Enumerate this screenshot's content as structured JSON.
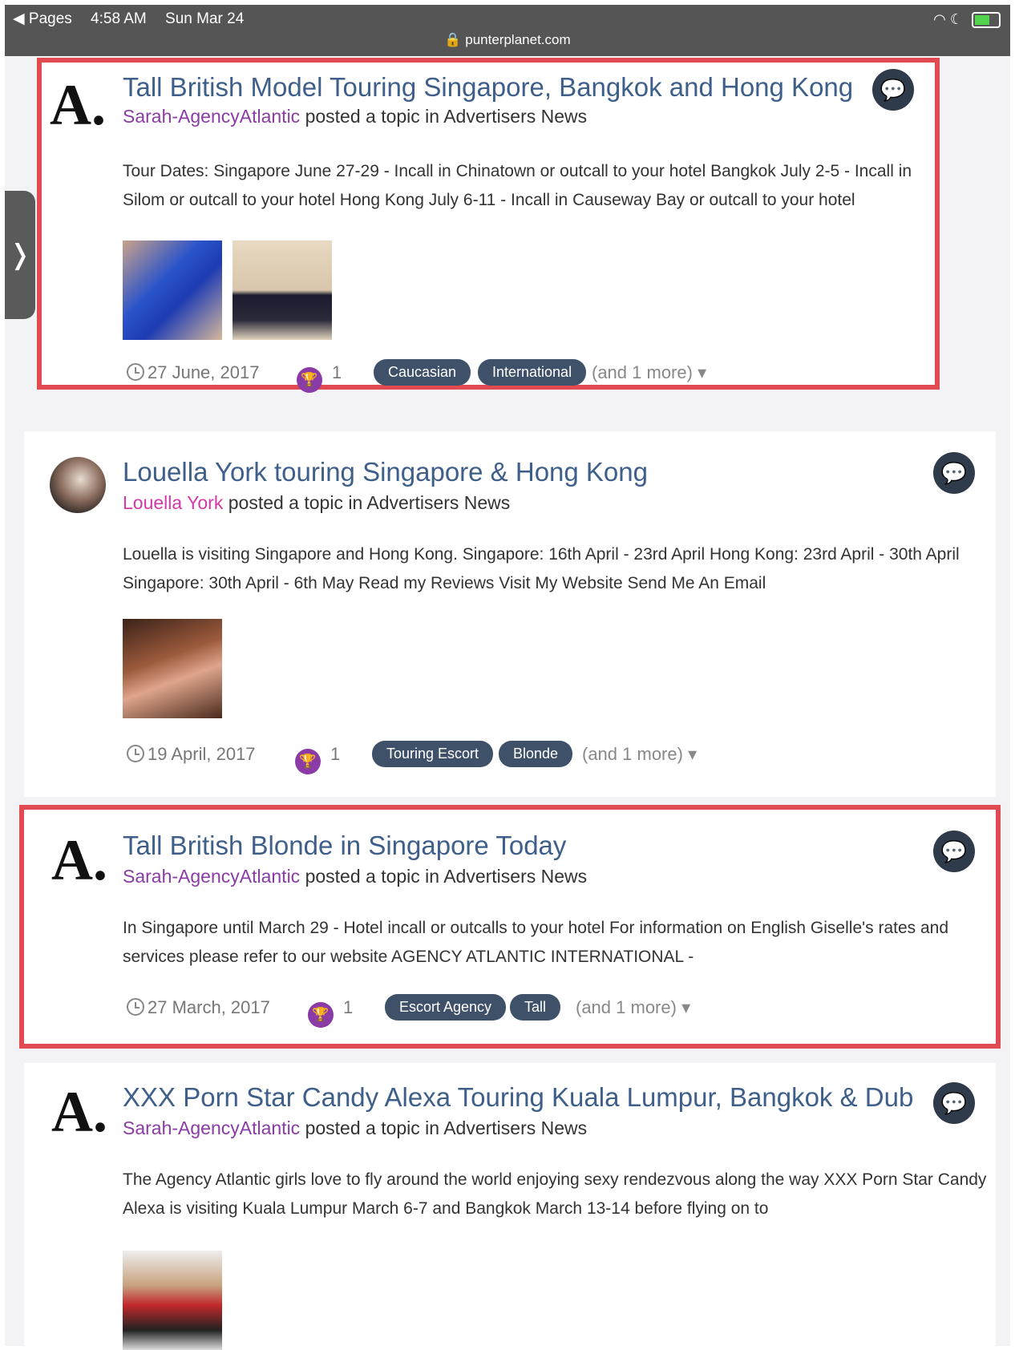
{
  "status_bar": {
    "back_app": "◀ Pages",
    "time": "4:58 AM",
    "date": "Sun Mar 24",
    "url": "punterplanet.com"
  },
  "sidebar_toggle": {
    "glyph": "❭"
  },
  "colors": {
    "highlight": "#e24a52",
    "title_link": "#3e5f8a",
    "author_purple": "#8a3ba5",
    "author_pink": "#d23aa8",
    "tag_bg": "#3f5069"
  },
  "posts": [
    {
      "title": "Tall British Model Touring Singapore, Bangkok and Hong Kong",
      "author": "Sarah-AgencyAtlantic",
      "byline_rest": " posted a topic in Advertisers News",
      "snippet": "Tour Dates: Singapore June 27-29 - Incall in Chinatown or outcall to your hotel Bangkok July 2-5 - Incall in Silom or outcall to your hotel Hong Kong July 6-11 - Incall in Causeway Bay or outcall to your hotel",
      "date": "27 June, 2017",
      "reactions": "1",
      "tags": [
        "Caucasian",
        "International"
      ],
      "more": "(and 1 more)",
      "avatar_text": "A.",
      "chat_icon": "chat-bubbles-icon"
    },
    {
      "title": "Louella York touring Singapore & Hong Kong",
      "author": "Louella York",
      "byline_rest": " posted a topic in Advertisers News",
      "snippet": "Louella is visiting Singapore and Hong Kong. Singapore: 16th April - 23rd April Hong Kong: 23rd April - 30th April Singapore: 30th April - 6th May Read my Reviews Visit My Website Send Me An Email",
      "date": "19 April, 2017",
      "reactions": "1",
      "tags": [
        "Touring Escort",
        "Blonde"
      ],
      "more": "(and 1 more)",
      "chat_icon": "chat-bubbles-icon"
    },
    {
      "title": "Tall British Blonde in Singapore Today",
      "author": "Sarah-AgencyAtlantic",
      "byline_rest": " posted a topic in Advertisers News",
      "snippet": "In Singapore until March 29 - Hotel incall or outcalls to your hotel For information on English Giselle's rates and services please refer to our website AGENCY ATLANTIC INTERNATIONAL -",
      "date": "27 March, 2017",
      "reactions": "1",
      "tags": [
        "Escort Agency",
        "Tall"
      ],
      "more": "(and 1 more)",
      "avatar_text": "A.",
      "chat_icon": "chat-bubbles-icon"
    },
    {
      "title": "XXX Porn Star Candy Alexa Touring Kuala Lumpur, Bangkok & Dub",
      "author": "Sarah-AgencyAtlantic",
      "byline_rest": " posted a topic in Advertisers News",
      "snippet": "The Agency Atlantic girls love to fly around the world enjoying sexy rendezvous along the way XXX Porn Star Candy Alexa is visiting Kuala Lumpur March 6-7 and Bangkok March 13-14 before flying on to",
      "avatar_text": "A.",
      "chat_icon": "chat-bubbles-icon"
    }
  ]
}
